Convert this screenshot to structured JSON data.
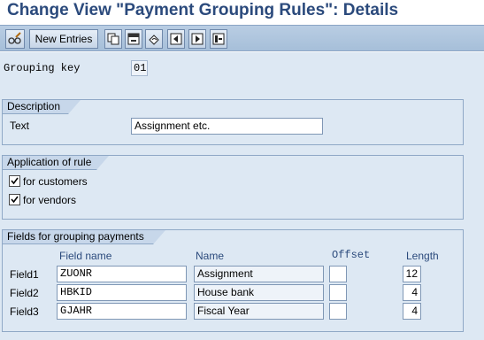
{
  "window": {
    "title": "Change View \"Payment Grouping Rules\": Details"
  },
  "toolbar": {
    "items": [
      {
        "icon": "glasses-pencil-icon"
      },
      {
        "label": "New Entries"
      },
      {
        "icon": "copy-icon"
      },
      {
        "icon": "delete-icon"
      },
      {
        "icon": "undo-icon"
      },
      {
        "icon": "previous-entry-icon"
      },
      {
        "icon": "next-entry-icon"
      },
      {
        "icon": "select-block-icon"
      }
    ]
  },
  "grouping_key": {
    "label": "Grouping key",
    "value": "01"
  },
  "description": {
    "heading": "Description",
    "text_label": "Text",
    "text_value": "Assignment etc."
  },
  "application": {
    "heading": "Application of rule",
    "options": [
      {
        "label": "for customers",
        "checked": true
      },
      {
        "label": "for vendors",
        "checked": true
      }
    ]
  },
  "fields": {
    "heading": "Fields for grouping payments",
    "columns": {
      "field_name": "Field name",
      "name": "Name",
      "offset": "Offset",
      "length": "Length"
    },
    "rows": [
      {
        "label": "Field1",
        "field_name": "ZUONR",
        "name": "Assignment",
        "offset": "",
        "length": "12"
      },
      {
        "label": "Field2",
        "field_name": "HBKID",
        "name": "House bank",
        "offset": "",
        "length": "4"
      },
      {
        "label": "Field3",
        "field_name": "GJAHR",
        "name": "Fiscal Year",
        "offset": "",
        "length": "4"
      }
    ]
  }
}
